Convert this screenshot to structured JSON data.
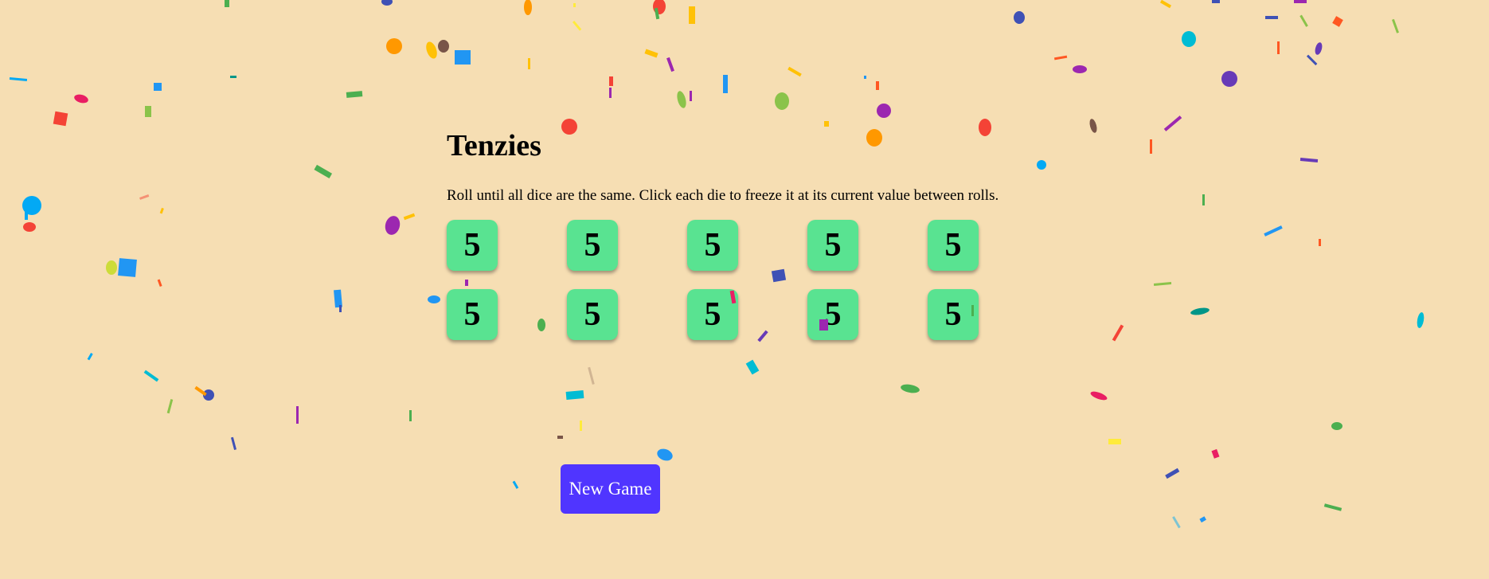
{
  "colors": {
    "background": "#f6deb3",
    "die_held": "#59e391",
    "button": "#5035ff",
    "button_text": "#ffffff",
    "text": "#000000"
  },
  "title": "Tenzies",
  "instructions": "Roll until all dice are the same. Click each die to freeze it at its current value between rolls.",
  "dice": [
    {
      "value": "5",
      "held": true
    },
    {
      "value": "5",
      "held": true
    },
    {
      "value": "5",
      "held": true
    },
    {
      "value": "5",
      "held": true
    },
    {
      "value": "5",
      "held": true
    },
    {
      "value": "5",
      "held": true
    },
    {
      "value": "5",
      "held": true
    },
    {
      "value": "5",
      "held": true
    },
    {
      "value": "5",
      "held": true
    },
    {
      "value": "5",
      "held": true
    }
  ],
  "new_game_button": "New Game",
  "confetti_colors": [
    "#f44336",
    "#e91e63",
    "#9c27b0",
    "#673ab7",
    "#3f51b5",
    "#2196f3",
    "#03a9f4",
    "#00bcd4",
    "#009688",
    "#4caf50",
    "#8bc34a",
    "#cddc39",
    "#ffeb3b",
    "#ffc107",
    "#ff9800",
    "#ff5722",
    "#795548"
  ]
}
